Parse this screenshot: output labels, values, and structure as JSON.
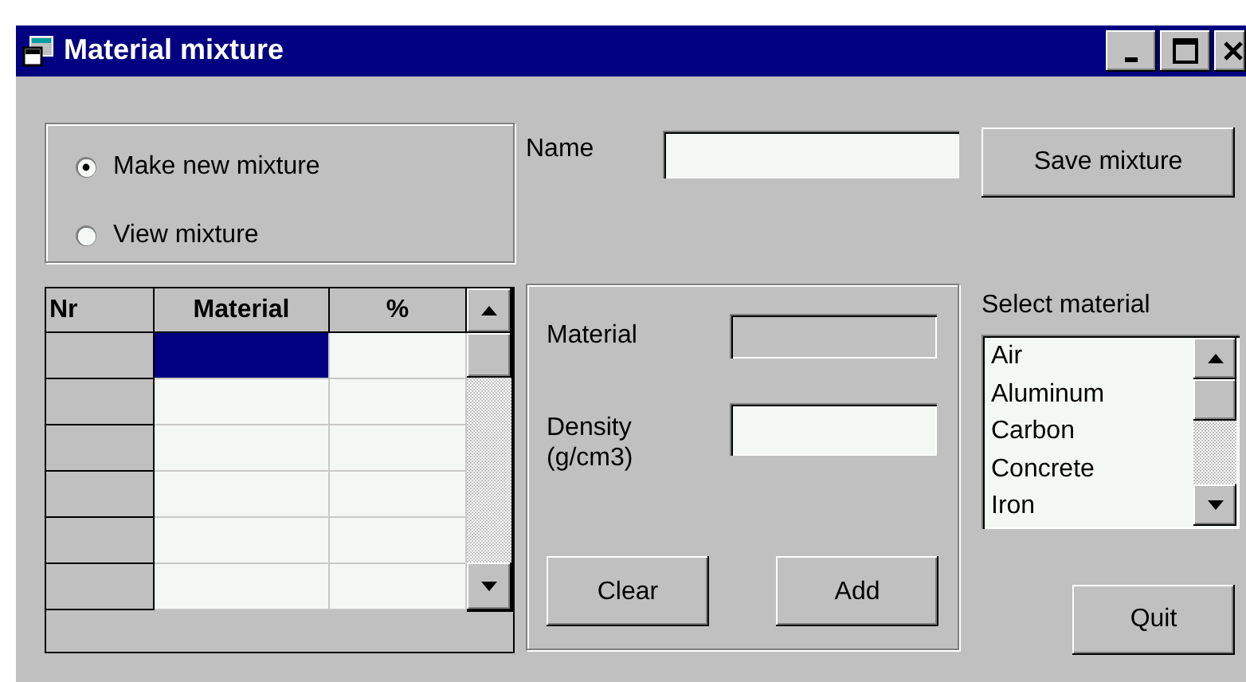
{
  "window": {
    "title": "Material mixture"
  },
  "mode_options": [
    {
      "label": "Make new mixture",
      "selected": true
    },
    {
      "label": "View mixture",
      "selected": false
    }
  ],
  "name_field": {
    "label": "Name"
  },
  "save_button": "Save mixture",
  "grid": {
    "columns": [
      "Nr",
      "Material",
      "%"
    ],
    "rows": [
      {
        "selected": true
      },
      {
        "selected": false
      },
      {
        "selected": false
      },
      {
        "selected": false
      },
      {
        "selected": false
      },
      {
        "selected": false
      }
    ]
  },
  "editor": {
    "fields": [
      {
        "label": "Material",
        "disabled": true
      },
      {
        "label": "Density (g/cm3)",
        "disabled": false
      }
    ],
    "buttons": [
      "Clear",
      "Add"
    ]
  },
  "select_material": {
    "label": "Select material",
    "items": [
      "Air",
      "Aluminum",
      "Carbon",
      "Concrete",
      "Iron"
    ]
  },
  "quit_button": "Quit"
}
